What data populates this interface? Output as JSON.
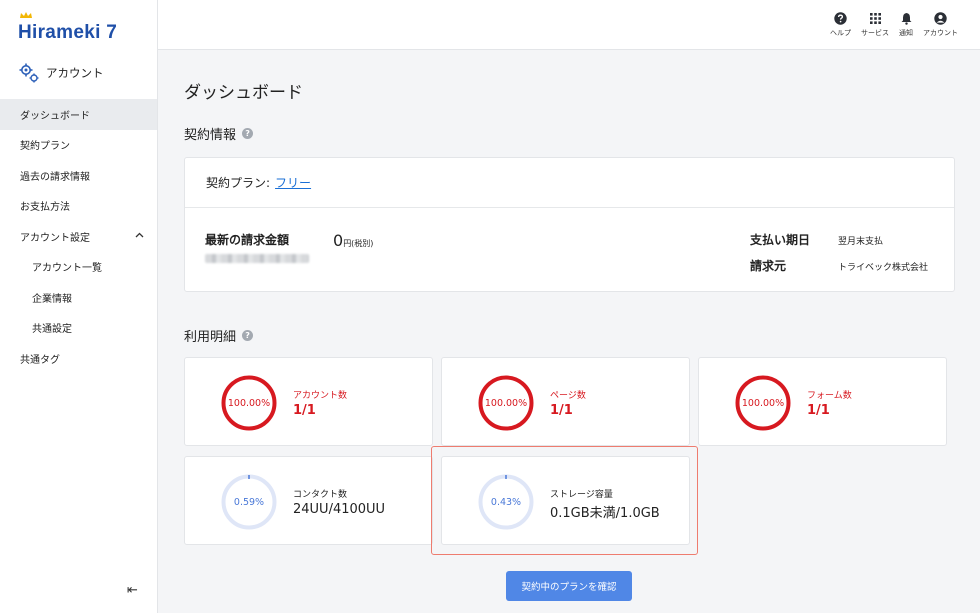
{
  "app": {
    "logo_text": "Hirameki 7"
  },
  "sidebar": {
    "section_label": "アカウント",
    "items": [
      {
        "label": "ダッシュボード"
      },
      {
        "label": "契約プラン"
      },
      {
        "label": "過去の請求情報"
      },
      {
        "label": "お支払方法"
      },
      {
        "label": "アカウント設定"
      },
      {
        "label": "アカウント一覧"
      },
      {
        "label": "企業情報"
      },
      {
        "label": "共通設定"
      },
      {
        "label": "共通タグ"
      }
    ],
    "collapse_icon": "collapse-left-icon",
    "collapse_glyph": "⇤"
  },
  "topbar": {
    "help_label": "ヘルプ",
    "services_label": "サービス",
    "notify_label": "通知",
    "account_label": "アカウント"
  },
  "page": {
    "title": "ダッシュボード"
  },
  "contract": {
    "section_title": "契約情報",
    "plan_label": "契約プラン:",
    "plan_value": "フリー",
    "billing_label": "最新の請求金額",
    "amount": "0",
    "amount_unit": "円(税別)",
    "due_label": "支払い期日",
    "due_value": "翌月末支払",
    "issuer_label": "請求元",
    "issuer_value": "トライベック株式会社"
  },
  "usage": {
    "section_title": "利用明細",
    "cards": [
      {
        "percent_label": "100.00%",
        "label": "アカウント数",
        "value": "1/1",
        "percent": 100
      },
      {
        "percent_label": "100.00%",
        "label": "ページ数",
        "value": "1/1",
        "percent": 100
      },
      {
        "percent_label": "100.00%",
        "label": "フォーム数",
        "value": "1/1",
        "percent": 100
      },
      {
        "percent_label": "0.59%",
        "label": "コンタクト数",
        "value": "24UU/4100UU",
        "percent": 0.59
      },
      {
        "percent_label": "0.43%",
        "label": "ストレージ容量",
        "value": "0.1GB未満/1.0GB",
        "percent": 0.43
      }
    ]
  },
  "actions": {
    "confirm_plan": "契約中のプランを確認"
  },
  "colors": {
    "accent": "#5087e6",
    "danger": "#d71920",
    "ring_track": "#dfe6f7",
    "ring_progress": "#4a79d8",
    "highlight": "#ee7c6f"
  }
}
